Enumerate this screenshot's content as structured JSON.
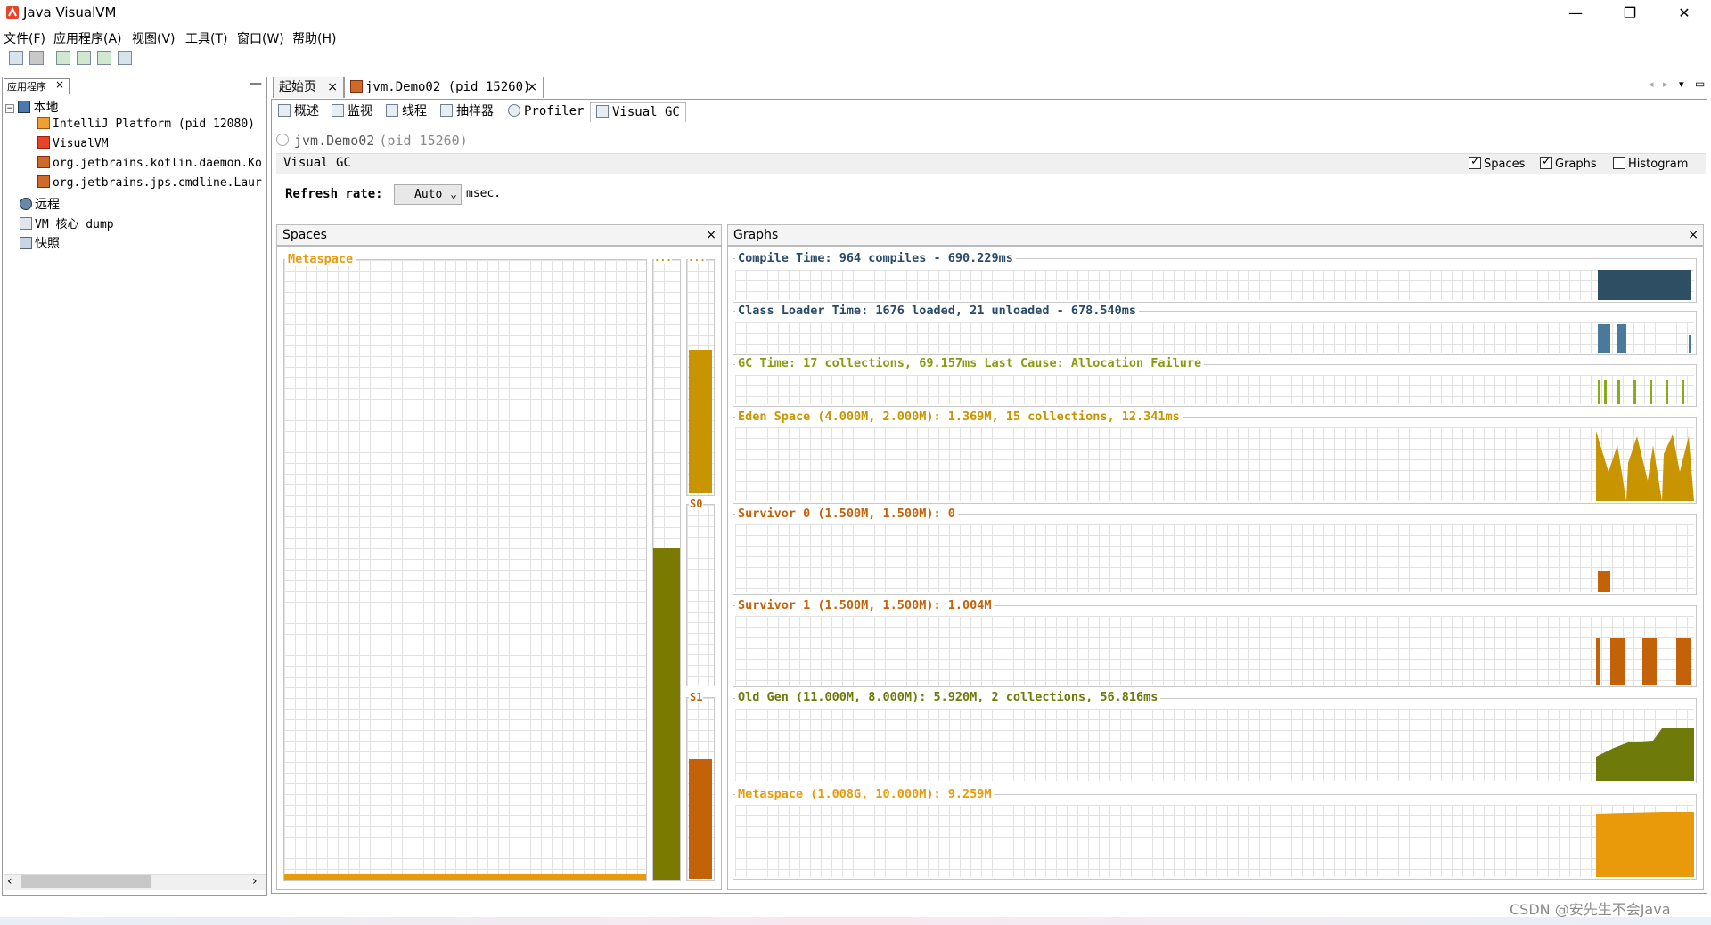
{
  "window": {
    "title": "Java VisualVM",
    "minimize": "—",
    "maximize": "❐",
    "close": "✕"
  },
  "menu": [
    "文件(F)",
    "应用程序(A)",
    "视图(V)",
    "工具(T)",
    "窗口(W)",
    "帮助(H)"
  ],
  "left_panel": {
    "tab": "应用程序",
    "close": "×",
    "minimize": "—",
    "tree": {
      "local": "本地",
      "local_children": [
        "IntelliJ Platform (pid 12080)",
        "VisualVM",
        "org.jetbrains.kotlin.daemon.Ko",
        "org.jetbrains.jps.cmdline.Laur"
      ],
      "remote": "远程",
      "core_dump": "VM 核心 dump",
      "snapshots": "快照"
    }
  },
  "doc_tabs": [
    {
      "label": "起始页",
      "close": "×"
    },
    {
      "label": "jvm.Demo02 (pid 15260)",
      "close": "×"
    }
  ],
  "sub_tabs": [
    "概述",
    "监视",
    "线程",
    "抽样器",
    "Profiler",
    "Visual GC"
  ],
  "vm": {
    "name": "jvm.Demo02",
    "pid": "(pid 15260)"
  },
  "visual_gc": {
    "header": "Visual GC",
    "options": [
      {
        "label": "Spaces",
        "checked": true
      },
      {
        "label": "Graphs",
        "checked": true
      },
      {
        "label": "Histogram",
        "checked": false
      }
    ],
    "refresh_label": "Refresh rate:",
    "refresh_value": "Auto",
    "refresh_unit": "msec."
  },
  "spaces_panel": {
    "title": "Spaces",
    "close": "×",
    "metaspace_label": "Metaspace",
    "old_label": "...",
    "eden_label": "...",
    "s0_label": "S0",
    "s1_label": "S1",
    "fill": {
      "metaspace": 0.01,
      "old": 0.54,
      "eden": 0.62,
      "s0": 0.0,
      "s1": 0.67
    }
  },
  "graphs_panel": {
    "title": "Graphs",
    "close": "×",
    "graphs": [
      {
        "label": "Compile Time: 964 compiles - 690.229ms",
        "color": "#2e4e64"
      },
      {
        "label": "Class Loader Time: 1676 loaded, 21 unloaded - 678.540ms",
        "color": "#4a7a9a"
      },
      {
        "label": "GC Time: 17 collections, 69.157ms Last Cause: Allocation Failure",
        "color": "#8aaa1a"
      },
      {
        "label": "Eden Space (4.000M, 2.000M): 1.369M, 15 collections, 12.341ms",
        "color": "#c89400"
      },
      {
        "label": "Survivor 0 (1.500M, 1.500M): 0",
        "color": "#c4620a"
      },
      {
        "label": "Survivor 1 (1.500M, 1.500M): 1.004M",
        "color": "#c4620a"
      },
      {
        "label": "Old Gen (11.000M, 8.000M): 5.920M, 2 collections, 56.816ms",
        "color": "#7a7a00"
      },
      {
        "label": "Metaspace (1.008G, 10.000M): 9.259M",
        "color": "#e89a0a"
      }
    ]
  },
  "colors": {
    "metaspace": "#e89a0a",
    "old": "#7a7a00",
    "eden": "#c89400",
    "survivor": "#c4620a",
    "label_blue": "#2a4a6a",
    "label_orange": "#c89400"
  },
  "watermark": "CSDN @安先生不会Java"
}
